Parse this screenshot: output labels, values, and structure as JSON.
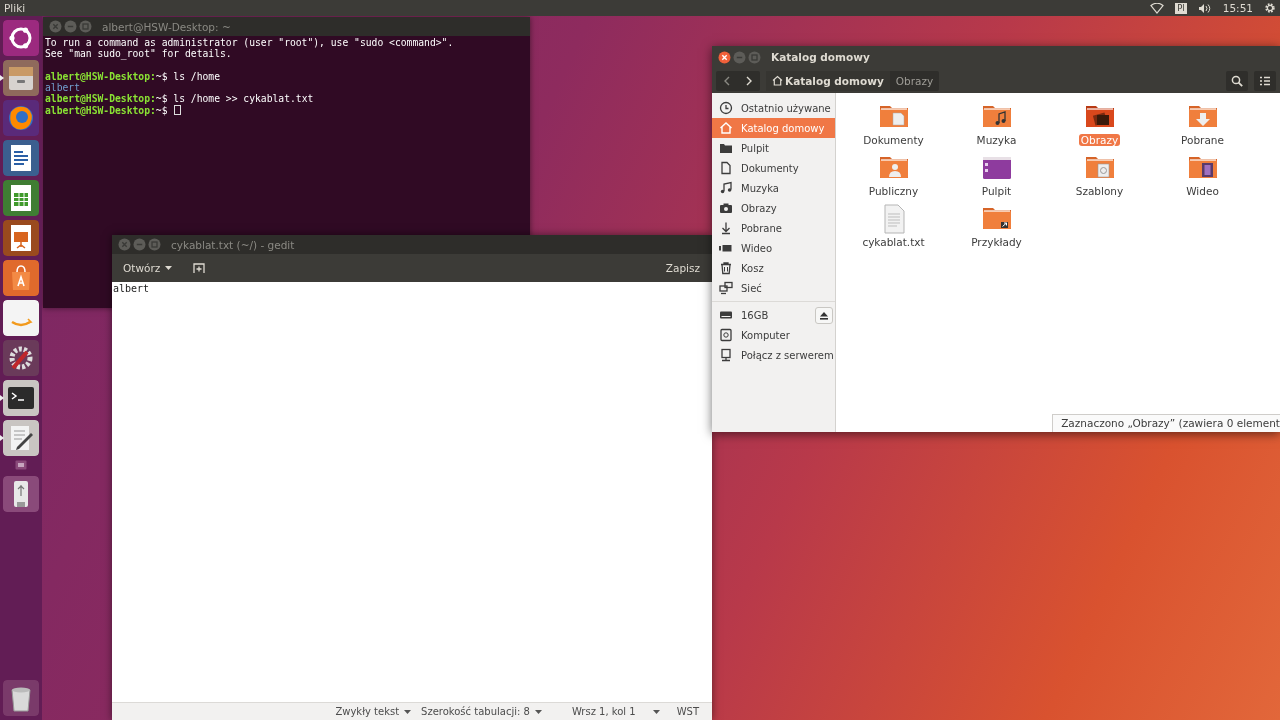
{
  "top_panel": {
    "app_name": "Pliki",
    "keyboard_layout": "Pl",
    "clock": "15:51"
  },
  "launcher": {
    "items": [
      {
        "kind": "ubuntu",
        "running": false
      },
      {
        "kind": "files",
        "running": true
      },
      {
        "kind": "browser",
        "running": false
      },
      {
        "kind": "writer",
        "running": false
      },
      {
        "kind": "calc",
        "running": false
      },
      {
        "kind": "impress",
        "running": false
      },
      {
        "kind": "store",
        "running": false
      },
      {
        "kind": "amazon",
        "running": false
      },
      {
        "kind": "settings",
        "running": false
      },
      {
        "kind": "terminal",
        "running": true
      },
      {
        "kind": "editor",
        "running": true
      },
      {
        "kind": "small",
        "running": false
      },
      {
        "kind": "usb",
        "running": false
      },
      {
        "kind": "trash",
        "running": false
      }
    ]
  },
  "terminal": {
    "title": "albert@HSW-Desktop: ~",
    "focused": false,
    "lines": [
      {
        "kind": "output",
        "text": "To run a command as administrator (user \"root\"), use \"sudo <command>\"."
      },
      {
        "kind": "output",
        "text": "See \"man sudo_root\" for details."
      },
      {
        "kind": "blank"
      },
      {
        "kind": "prompt",
        "prompt": "albert@HSW-Desktop:",
        "command": "~$ ls /home"
      },
      {
        "kind": "dir",
        "text": "albert"
      },
      {
        "kind": "prompt",
        "prompt": "albert@HSW-Desktop:",
        "command": "~$ ls /home >> cykablat.txt"
      },
      {
        "kind": "prompt",
        "prompt": "albert@HSW-Desktop:",
        "command": "~$",
        "cursor": true
      }
    ]
  },
  "files": {
    "title": "Katalog domowy",
    "focused": true,
    "path_bar": [
      {
        "label": "Katalog domowy",
        "selected": true
      },
      {
        "label": "Obrazy",
        "selected": false
      }
    ],
    "places": [
      {
        "kind": "recent",
        "label": "Ostatnio używane",
        "selected": false
      },
      {
        "kind": "home",
        "label": "Katalog domowy",
        "selected": true
      },
      {
        "kind": "desktop",
        "label": "Pulpit",
        "selected": false
      },
      {
        "kind": "document",
        "label": "Dokumenty",
        "selected": false
      },
      {
        "kind": "music",
        "label": "Muzyka",
        "selected": false
      },
      {
        "kind": "camera",
        "label": "Obrazy",
        "selected": false
      },
      {
        "kind": "download",
        "label": "Pobrane",
        "selected": false
      },
      {
        "kind": "video",
        "label": "Wideo",
        "selected": false
      },
      {
        "kind": "trash",
        "label": "Kosz",
        "selected": false
      },
      {
        "kind": "network",
        "label": "Sieć",
        "selected": false
      }
    ],
    "devices": [
      {
        "kind": "drive",
        "label": "16GB",
        "selected": false,
        "ejectable": true
      },
      {
        "kind": "computer",
        "label": "Komputer",
        "selected": false,
        "ejectable": false
      },
      {
        "kind": "server",
        "label": "Połącz z serwerem",
        "selected": false,
        "ejectable": false
      }
    ],
    "items": [
      {
        "kind": "documents",
        "name": "Dokumenty",
        "selected": false
      },
      {
        "kind": "music",
        "name": "Muzyka",
        "selected": false
      },
      {
        "kind": "pictures",
        "name": "Obrazy",
        "selected": true
      },
      {
        "kind": "downloads",
        "name": "Pobrane",
        "selected": false
      },
      {
        "kind": "public",
        "name": "Publiczny",
        "selected": false
      },
      {
        "kind": "desktop",
        "name": "Pulpit",
        "selected": false
      },
      {
        "kind": "templates",
        "name": "Szablony",
        "selected": false
      },
      {
        "kind": "videos",
        "name": "Wideo",
        "selected": false
      },
      {
        "kind": "textfile",
        "name": "cykablat.txt",
        "selected": false
      },
      {
        "kind": "link",
        "name": "Przykłady",
        "selected": false
      }
    ],
    "status": "Zaznaczono „Obrazy” (zawiera 0 element"
  },
  "gedit": {
    "title": "cykablat.txt (~/) - gedit",
    "focused": false,
    "open_button": "Otwórz",
    "save_button": "Zapisz",
    "content": "albert",
    "status": [
      "Zwykły tekst",
      "Szerokość tabulacji: 8",
      "Wrsz 1, kol 1",
      "WST"
    ]
  }
}
